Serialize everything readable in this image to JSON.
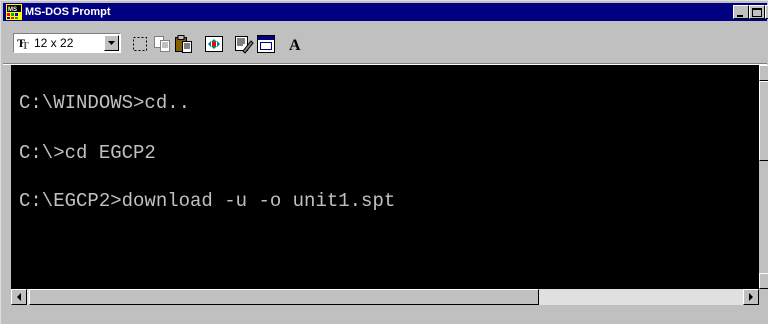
{
  "window": {
    "title": "MS-DOS Prompt"
  },
  "toolbar": {
    "font_size_value": "12 x 22",
    "font_type_glyph": "T",
    "font_button_label": "A",
    "buttons": [
      "mark-icon",
      "copy-icon",
      "paste-icon",
      "fullscreen-icon",
      "properties-icon",
      "background-icon",
      "font-icon"
    ]
  },
  "console": {
    "lines": [
      "C:\\WINDOWS>cd..",
      "C:\\>cd EGCP2",
      "C:\\EGCP2>download -u -o unit1.spt"
    ],
    "text_color": "#c0c0c0",
    "background_color": "#000000"
  },
  "colors": {
    "titlebar": "#000080",
    "chrome": "#c0c0c0"
  }
}
